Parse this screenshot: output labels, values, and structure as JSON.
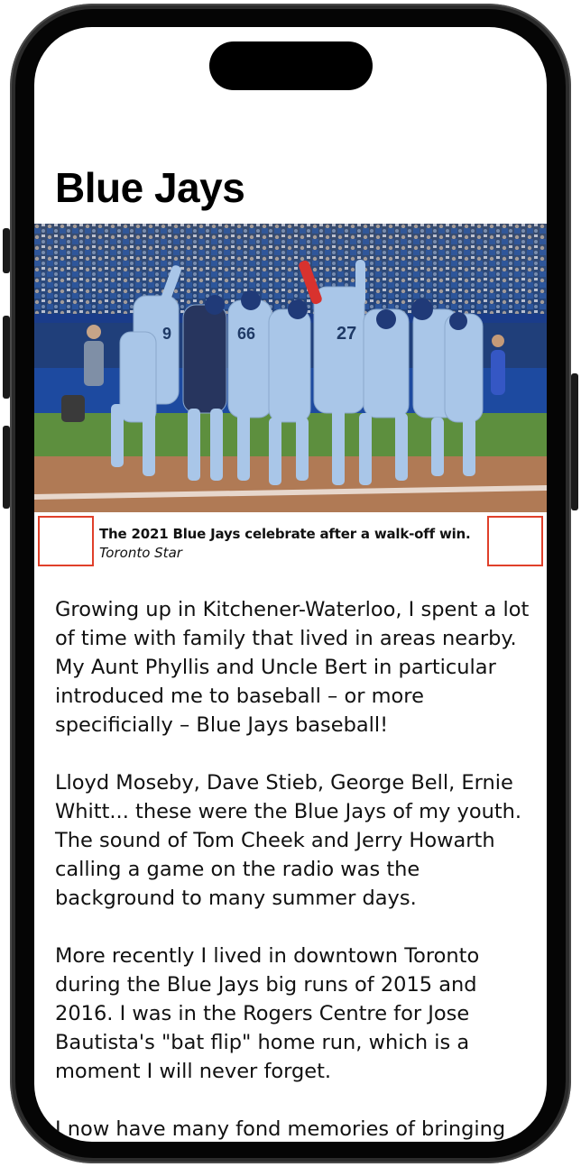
{
  "article": {
    "title": "Blue Jays",
    "photo": {
      "caption": "The 2021 Blue Jays celebrate after a walk-off win.",
      "credit": "Toronto Star"
    },
    "paragraphs": [
      "Growing up in Kitchener-Waterloo, I spent a lot of time with family that lived in areas nearby. My Aunt Phyllis and Uncle Bert in particular introduced me to baseball – or more specificially – Blue Jays baseball!",
      "Lloyd Moseby, Dave Stieb, George Bell, Ernie Whitt... these were the Blue Jays of my youth. The sound of Tom Cheek and Jerry Howarth calling a game on the radio was the background to many summer days.",
      "More recently I lived in downtown Toronto during the Blue Jays big runs of 2015 and 2016. I was in the Rogers Centre for Jose Bautista's \"bat flip\" home run, which is a moment I will never forget.",
      "I now have many fond memories of bringing my"
    ]
  },
  "colors": {
    "highlight_box": "#e0402a",
    "uniform": "#a9c6e8",
    "crowd": "#1f3a66",
    "grass": "#5d8f3e",
    "dirt": "#b07a55"
  }
}
